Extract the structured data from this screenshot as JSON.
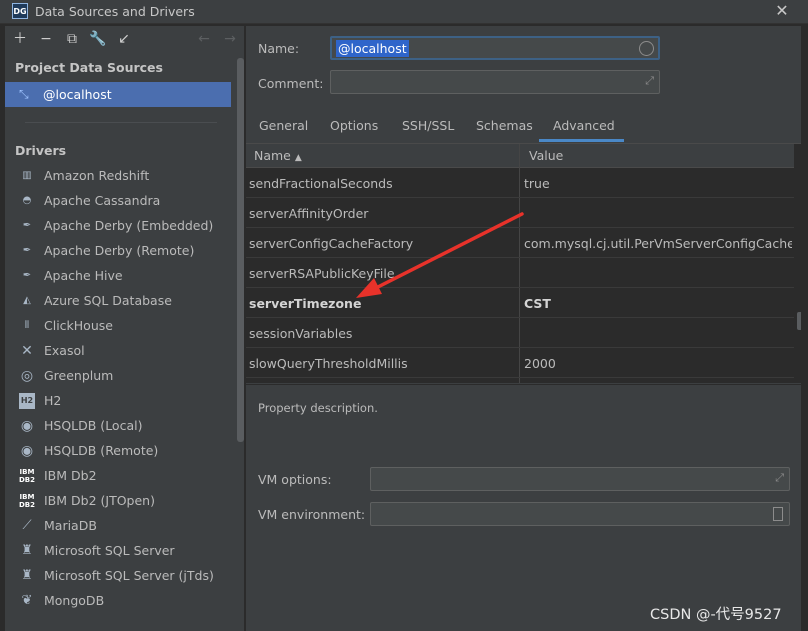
{
  "window": {
    "title": "Data Sources and Drivers",
    "logo_text": "DG"
  },
  "toolbar": {
    "icons": [
      "add-icon",
      "remove-icon",
      "duplicate-icon",
      "settings-icon",
      "import-icon",
      "back-icon",
      "forward-icon"
    ]
  },
  "left": {
    "project_header": "Project Data Sources",
    "selected": "@localhost",
    "drivers_header": "Drivers",
    "drivers": [
      "Amazon Redshift",
      "Apache Cassandra",
      "Apache Derby (Embedded)",
      "Apache Derby (Remote)",
      "Apache Hive",
      "Azure SQL Database",
      "ClickHouse",
      "Exasol",
      "Greenplum",
      "H2",
      "HSQLDB (Local)",
      "HSQLDB (Remote)",
      "IBM Db2",
      "IBM Db2 (JTOpen)",
      "MariaDB",
      "Microsoft SQL Server",
      "Microsoft SQL Server (jTds)",
      "MongoDB"
    ]
  },
  "form": {
    "name_label": "Name:",
    "name_value": "@localhost",
    "comment_label": "Comment:",
    "comment_value": ""
  },
  "tabs": [
    "General",
    "Options",
    "SSH/SSL",
    "Schemas",
    "Advanced"
  ],
  "active_tab": "Advanced",
  "table": {
    "headers": {
      "name": "Name",
      "value": "Value"
    },
    "rows": [
      {
        "name": "sendFractionalSeconds",
        "value": "true"
      },
      {
        "name": "serverAffinityOrder",
        "value": ""
      },
      {
        "name": "serverConfigCacheFactory",
        "value": "com.mysql.cj.util.PerVmServerConfigCacheFa..."
      },
      {
        "name": "serverRSAPublicKeyFile",
        "value": ""
      },
      {
        "name": "serverTimezone",
        "value": "CST"
      },
      {
        "name": "sessionVariables",
        "value": ""
      },
      {
        "name": "slowQueryThresholdMillis",
        "value": "2000"
      }
    ]
  },
  "description": "Property description.",
  "vm": {
    "options_label": "VM options:",
    "options_value": "",
    "env_label": "VM environment:",
    "env_value": ""
  },
  "watermark": "CSDN @-代号9527",
  "colors": {
    "accent": "#4b6eaf",
    "annotation_arrow": "#e8322a",
    "tab_underline": "#4a88c7"
  }
}
